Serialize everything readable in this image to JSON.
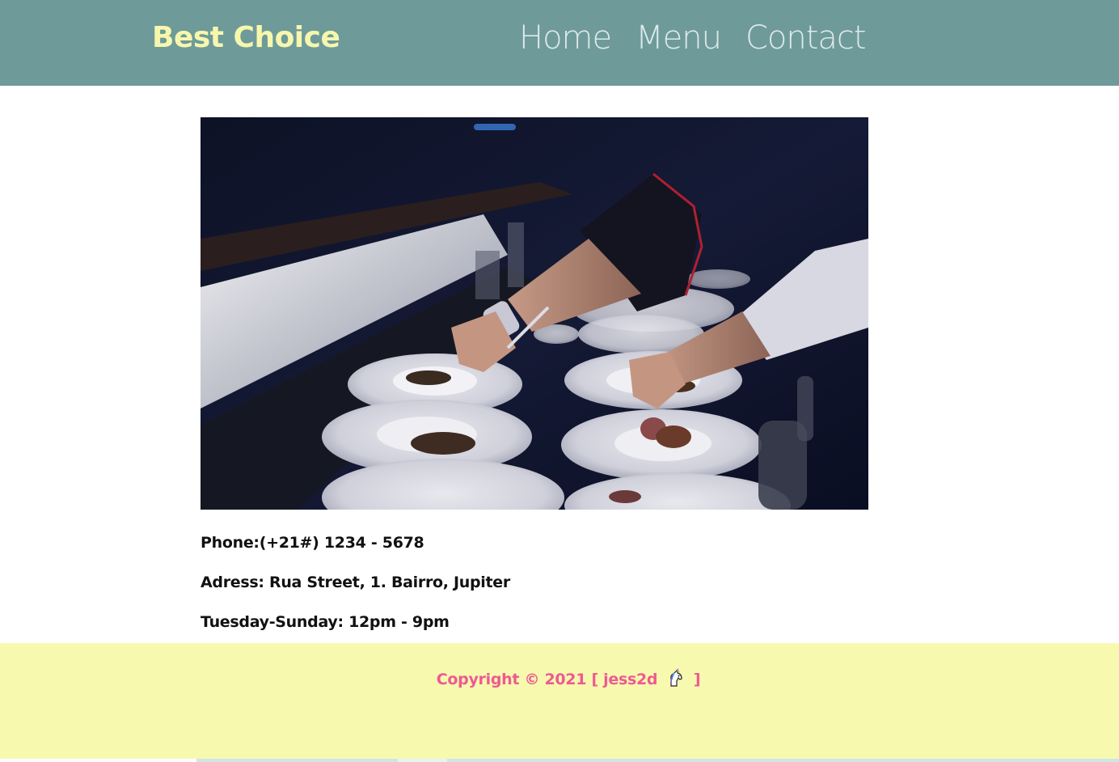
{
  "header": {
    "brand": "Best Choice",
    "nav": [
      {
        "label": "Home"
      },
      {
        "label": "Menu"
      },
      {
        "label": "Contact"
      }
    ],
    "colors": {
      "background": "#6e9a9a",
      "brand": "#f7f7ac",
      "nav": "#e8f0f0"
    }
  },
  "hero": {
    "icon": "photo-chef-plating-dishes"
  },
  "contact": {
    "phone": "Phone:(+21#) 1234 - 5678",
    "address": "Adress: Rua Street, 1. Bairro, Jupiter",
    "hours": "Tuesday-Sunday: 12pm - 9pm"
  },
  "footer": {
    "copyright_prefix": "Copyright © 2021 [ jess2d",
    "copyright_suffix": "]",
    "icon": "unicorn-icon",
    "colors": {
      "background": "#f7f9ae",
      "text": "#ee5a92"
    }
  }
}
